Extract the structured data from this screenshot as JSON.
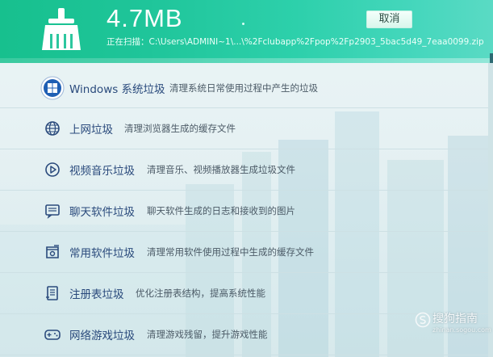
{
  "header": {
    "size": "4.7MB",
    "cancel_label": "取消",
    "scan_path": "正在扫描：C:\\Users\\ADMINI~1\\...\\%2Fclubapp%2Fpop%2Fp2903_5bac5d49_7eaa0099.zip",
    "brand_color": "#1fc59a"
  },
  "categories": [
    {
      "icon": "windows-icon",
      "title": "Windows 系统垃圾",
      "desc": "清理系统日常使用过程中产生的垃圾"
    },
    {
      "icon": "globe-icon",
      "title": "上网垃圾",
      "desc": "清理浏览器生成的缓存文件"
    },
    {
      "icon": "play-icon",
      "title": "视频音乐垃圾",
      "desc": "清理音乐、视频播放器生成垃圾文件"
    },
    {
      "icon": "chat-icon",
      "title": "聊天软件垃圾",
      "desc": "聊天软件生成的日志和接收到的图片"
    },
    {
      "icon": "software-icon",
      "title": "常用软件垃圾",
      "desc": "清理常用软件使用过程中生成的缓存文件"
    },
    {
      "icon": "registry-icon",
      "title": "注册表垃圾",
      "desc": "优化注册表结构，提高系统性能"
    },
    {
      "icon": "gamepad-icon",
      "title": "网络游戏垃圾",
      "desc": "清理游戏残留，提升游戏性能"
    }
  ],
  "watermark": {
    "main": "搜狗指南",
    "sub": "zhinan.sogou.com"
  }
}
